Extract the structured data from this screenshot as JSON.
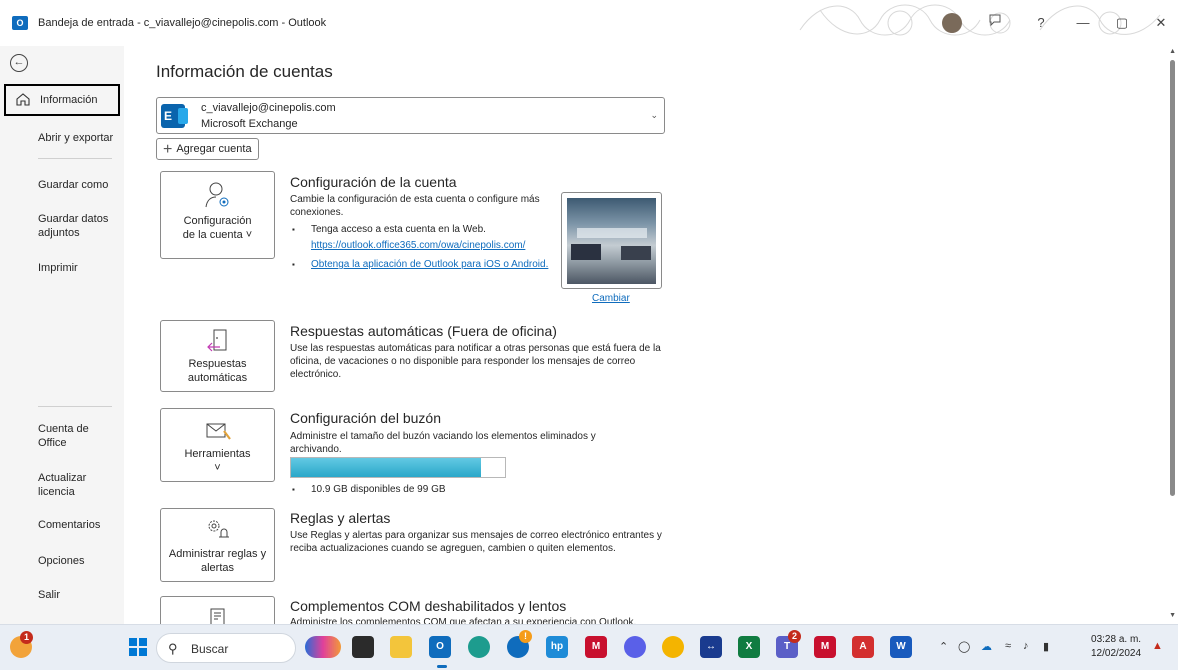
{
  "window": {
    "title": "Bandeja de entrada - c_viavallejo@cinepolis.com - Outlook",
    "app_icon": "O",
    "help_glyph": "?",
    "controls": [
      "—",
      "▢",
      "✕"
    ]
  },
  "nav": {
    "back_icon": "←",
    "items": [
      {
        "label": "Información",
        "active": true
      },
      {
        "label": "Abrir y exportar"
      },
      {
        "label": "Guardar como"
      },
      {
        "label": "Guardar datos adjuntos"
      },
      {
        "label": "Imprimir"
      },
      {
        "label": "Cuenta de Office"
      },
      {
        "label": "Actualizar licencia"
      },
      {
        "label": "Comentarios"
      },
      {
        "label": "Opciones"
      },
      {
        "label": "Salir"
      }
    ]
  },
  "main": {
    "title": "Información de cuentas",
    "account": {
      "email": "c_viavallejo@cinepolis.com",
      "type": "Microsoft Exchange",
      "icon_letter": "E"
    },
    "add_account": "Agregar cuenta",
    "sections": {
      "account_settings": {
        "tile_line1": "Configuración",
        "tile_line2": "de la cuenta ˅",
        "title": "Configuración de la cuenta",
        "desc": "Cambie la configuración de esta cuenta o configure más conexiones.",
        "bullet1": "Tenga acceso a esta cuenta en la Web.",
        "bullet1_link": "https://outlook.office365.com/owa/cinepolis.com/",
        "bullet2_link": "Obtenga la aplicación de Outlook para iOS o Android.",
        "change_photo": "Cambiar"
      },
      "auto_replies": {
        "tile_line1": "Respuestas",
        "tile_line2": "automáticas",
        "title": "Respuestas automáticas (Fuera de oficina)",
        "desc": "Use las respuestas automáticas para notificar a otras personas que está fuera de la oficina, de vacaciones o no disponible para responder los mensajes de correo electrónico."
      },
      "mailbox": {
        "tile_line1": "Herramientas",
        "tile_line2": "˅",
        "title": "Configuración del buzón",
        "desc": "Administre el tamaño del buzón vaciando los elementos eliminados y archivando.",
        "usage_fraction": 0.89,
        "storage_text": "10.9 GB disponibles de 99 GB"
      },
      "rules": {
        "tile_line1": "Administrar reglas y",
        "tile_line2": "alertas",
        "title": "Reglas y alertas",
        "desc": "Use Reglas y alertas para organizar sus mensajes de correo electrónico entrantes y reciba actualizaciones cuando se agreguen, cambien o quiten elementos."
      },
      "com_addins": {
        "title": "Complementos COM deshabilitados y lentos",
        "desc": "Administre los complementos COM que afectan a su experiencia con Outlook."
      }
    }
  },
  "taskbar": {
    "search_placeholder": "Buscar",
    "teams_badge": "2",
    "weather_badge": "1",
    "time": "03:28 a. m.",
    "date": "12/02/2024"
  }
}
